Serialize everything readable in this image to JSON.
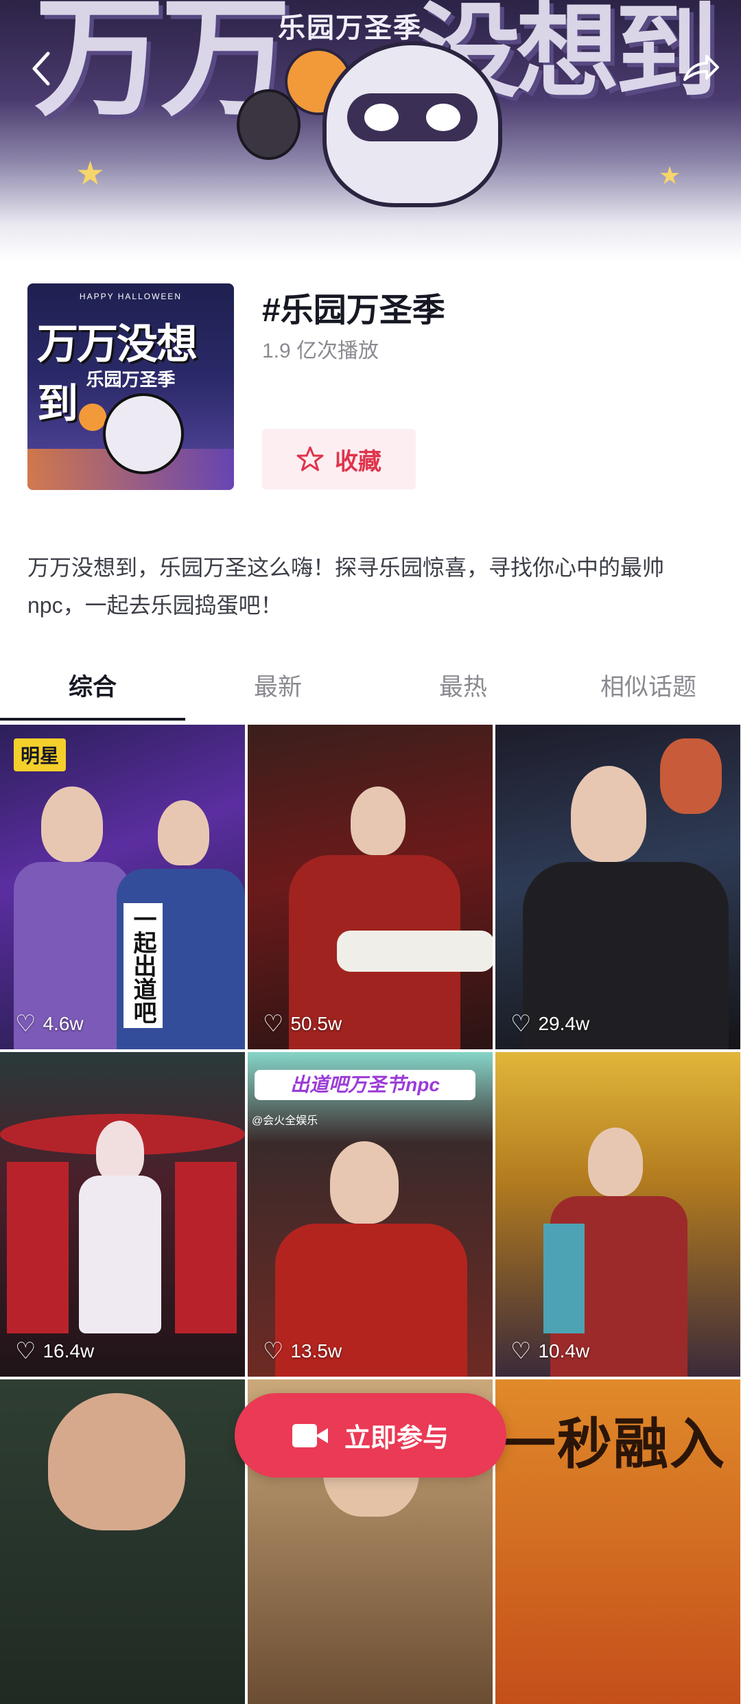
{
  "banner": {
    "left_text": "万万",
    "right_text": "没想到",
    "subtitle": "乐园万圣季"
  },
  "nav": {
    "back_icon": "chevron-left-icon",
    "share_icon": "share-arrow-icon"
  },
  "cover": {
    "top_text": "HAPPY HALLOWEEN",
    "title": "万万没想到",
    "subtitle": "乐园万圣季"
  },
  "topic": {
    "title": "#乐园万圣季",
    "plays": "1.9 亿次播放",
    "favorite_label": "收藏"
  },
  "description": "万万没想到，乐园万圣这么嗨！探寻乐园惊喜，寻找你心中的最帅npc，一起去乐园捣蛋吧！",
  "tabs": [
    {
      "label": "综合",
      "active": true
    },
    {
      "label": "最新",
      "active": false
    },
    {
      "label": "最热",
      "active": false
    },
    {
      "label": "相似话题",
      "active": false
    }
  ],
  "videos": [
    {
      "likes": "4.6w",
      "badge": "明星",
      "overlay": "一起出道吧"
    },
    {
      "likes": "50.5w"
    },
    {
      "likes": "29.4w"
    },
    {
      "likes": "16.4w"
    },
    {
      "likes": "13.5w",
      "overlay": "出道吧万圣节npc",
      "overlay2": "@会火全娱乐"
    },
    {
      "likes": "10.4w"
    },
    {
      "likes": ""
    },
    {
      "likes": ""
    },
    {
      "likes": "",
      "overlay": "一秒融入"
    }
  ],
  "join_button": {
    "label": "立即参与",
    "icon": "video-camera-icon"
  },
  "colors": {
    "accent": "#ea3a55",
    "favorite_bg": "#fdeef1",
    "badge": "#f5cf2b"
  }
}
